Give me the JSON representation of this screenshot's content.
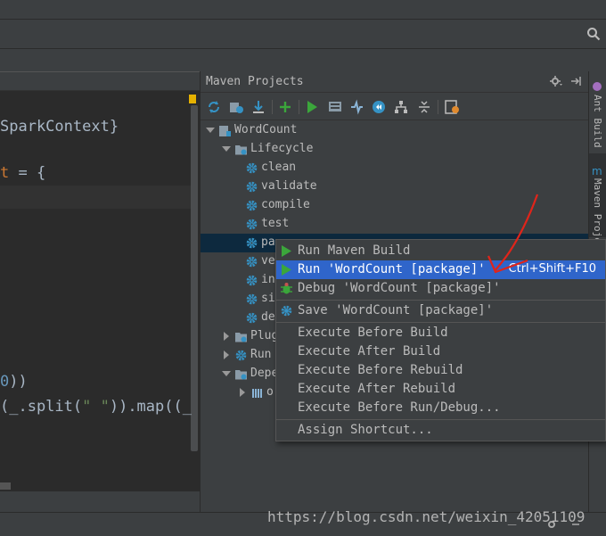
{
  "colors": {
    "background": "#3c3f41",
    "editor_bg": "#2b2b2b",
    "menu_highlight": "#2f65ca",
    "tree_selection": "#0d293e",
    "run_green": "#3ba63b",
    "gear_blue": "#3592c4",
    "annotation_red": "#e0241a"
  },
  "editor": {
    "lines": [
      {
        "text": "SparkContext}"
      },
      {
        "kw": "t",
        "text": " = {"
      },
      {
        "text": "0))",
        "num": "0"
      },
      {
        "text": "(_.split(",
        "str": "\" \"",
        "tail": ")).map((_"
      }
    ]
  },
  "maven": {
    "title": "Maven Projects",
    "toolbar_icons": [
      "reimport-icon",
      "generate-sources-icon",
      "download-icon",
      "add-icon",
      "run-icon",
      "execute-goal-icon",
      "toggle-offline-icon",
      "skip-tests-icon",
      "show-dependencies-icon",
      "collapse-all-icon",
      "settings-icon"
    ],
    "tree": [
      {
        "label": "WordCount",
        "level": 0,
        "expanded": true,
        "icon": "maven-module-icon"
      },
      {
        "label": "Lifecycle",
        "level": 1,
        "expanded": true,
        "icon": "folder-gear-icon"
      },
      {
        "label": "clean",
        "level": 2,
        "icon": "gear-icon"
      },
      {
        "label": "validate",
        "level": 2,
        "icon": "gear-icon"
      },
      {
        "label": "compile",
        "level": 2,
        "icon": "gear-icon"
      },
      {
        "label": "test",
        "level": 2,
        "icon": "gear-icon"
      },
      {
        "label": "pa",
        "level": 2,
        "icon": "gear-icon",
        "selected": true
      },
      {
        "label": "ve",
        "level": 2,
        "icon": "gear-icon"
      },
      {
        "label": "in",
        "level": 2,
        "icon": "gear-icon"
      },
      {
        "label": "si",
        "level": 2,
        "icon": "gear-icon"
      },
      {
        "label": "de",
        "level": 2,
        "icon": "gear-icon"
      },
      {
        "label": "Plug",
        "level": 1,
        "expanded": false,
        "icon": "folder-gear-icon"
      },
      {
        "label": "Run",
        "level": 1,
        "expanded": false,
        "icon": "gear-icon"
      },
      {
        "label": "Depe",
        "level": 1,
        "expanded": true,
        "icon": "folder-gear-icon"
      },
      {
        "label": "or",
        "level": 2,
        "expanded": false,
        "icon": "library-icon"
      }
    ]
  },
  "right_strip": {
    "ant_build": "Ant Build",
    "maven_projects": "Maven Projects"
  },
  "context_menu": {
    "items": [
      {
        "label": "Run Maven Build",
        "icon": "run-icon",
        "mnemonic": "R"
      },
      {
        "label": "Run 'WordCount [package]'",
        "icon": "run-icon",
        "shortcut": "Ctrl+Shift+F10",
        "active": true
      },
      {
        "label": "Debug 'WordCount [package]'",
        "icon": "debug-icon"
      },
      {
        "label": "Save 'WordCount [package]'",
        "icon": "save-config-icon",
        "separator_before": true
      },
      {
        "label": "Execute Before Build",
        "separator_before": true
      },
      {
        "label": "Execute After Build"
      },
      {
        "label": "Execute Before Rebuild"
      },
      {
        "label": "Execute After Rebuild"
      },
      {
        "label": "Execute Before Run/Debug..."
      },
      {
        "label": "Assign Shortcut...",
        "separator_before": true
      }
    ]
  },
  "watermark": "https://blog.csdn.net/weixin_42051109"
}
